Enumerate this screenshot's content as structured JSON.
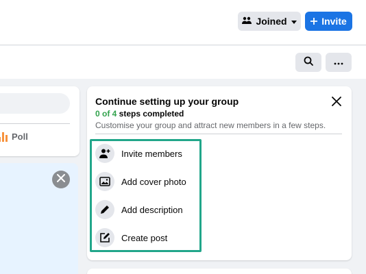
{
  "header": {
    "joined_label": "Joined",
    "invite_label": "Invite"
  },
  "left": {
    "poll_label": "Poll"
  },
  "setup": {
    "title": "Continue setting up your group",
    "steps_count": "0 of 4",
    "steps_suffix": " steps completed",
    "subtitle": "Customise your group and attract new members in a few steps.",
    "tasks": [
      {
        "label": "Invite members",
        "icon": "add-person-icon"
      },
      {
        "label": "Add cover photo",
        "icon": "photo-icon"
      },
      {
        "label": "Add description",
        "icon": "pencil-icon"
      },
      {
        "label": "Create post",
        "icon": "edit-square-icon"
      }
    ]
  },
  "colors": {
    "accent": "#1b74e4",
    "success": "#31a24c",
    "highlight": "#21a68a",
    "poll": "#f7923d"
  }
}
